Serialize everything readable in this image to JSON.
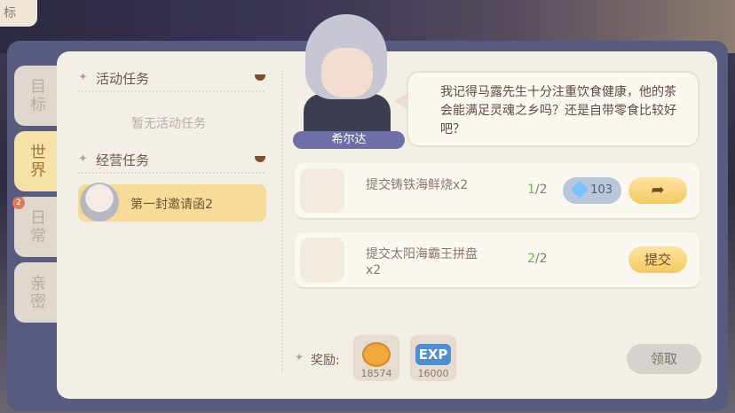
{
  "corner_text": "标",
  "tabs": [
    {
      "label": "目标"
    },
    {
      "label": "世界"
    },
    {
      "label": "日常"
    },
    {
      "label": "亲密"
    }
  ],
  "daily_badge": "2",
  "left": {
    "activity_title": "活动任务",
    "activity_empty": "暂无活动任务",
    "business_title": "经营任务",
    "quest_label": "第一封邀请函2"
  },
  "npc": {
    "name": "希尔达",
    "dialogue": "我记得马露先生十分注重饮食健康，他的茶会能满足灵魂之乡吗？还是自带零食比较好吧？"
  },
  "tasks": [
    {
      "desc": "提交铸铁海鲜烧x2",
      "count_done": "1",
      "count_total": "/2",
      "reward": "103"
    },
    {
      "desc": "提交太阳海霸王拼盘x2",
      "count_done": "2",
      "count_total": "/2",
      "button": "提交"
    }
  ],
  "rewards": {
    "label": "奖励:",
    "coin_amount": "18574",
    "exp_label": "EXP",
    "exp_amount": "16000",
    "claim": "领取"
  }
}
